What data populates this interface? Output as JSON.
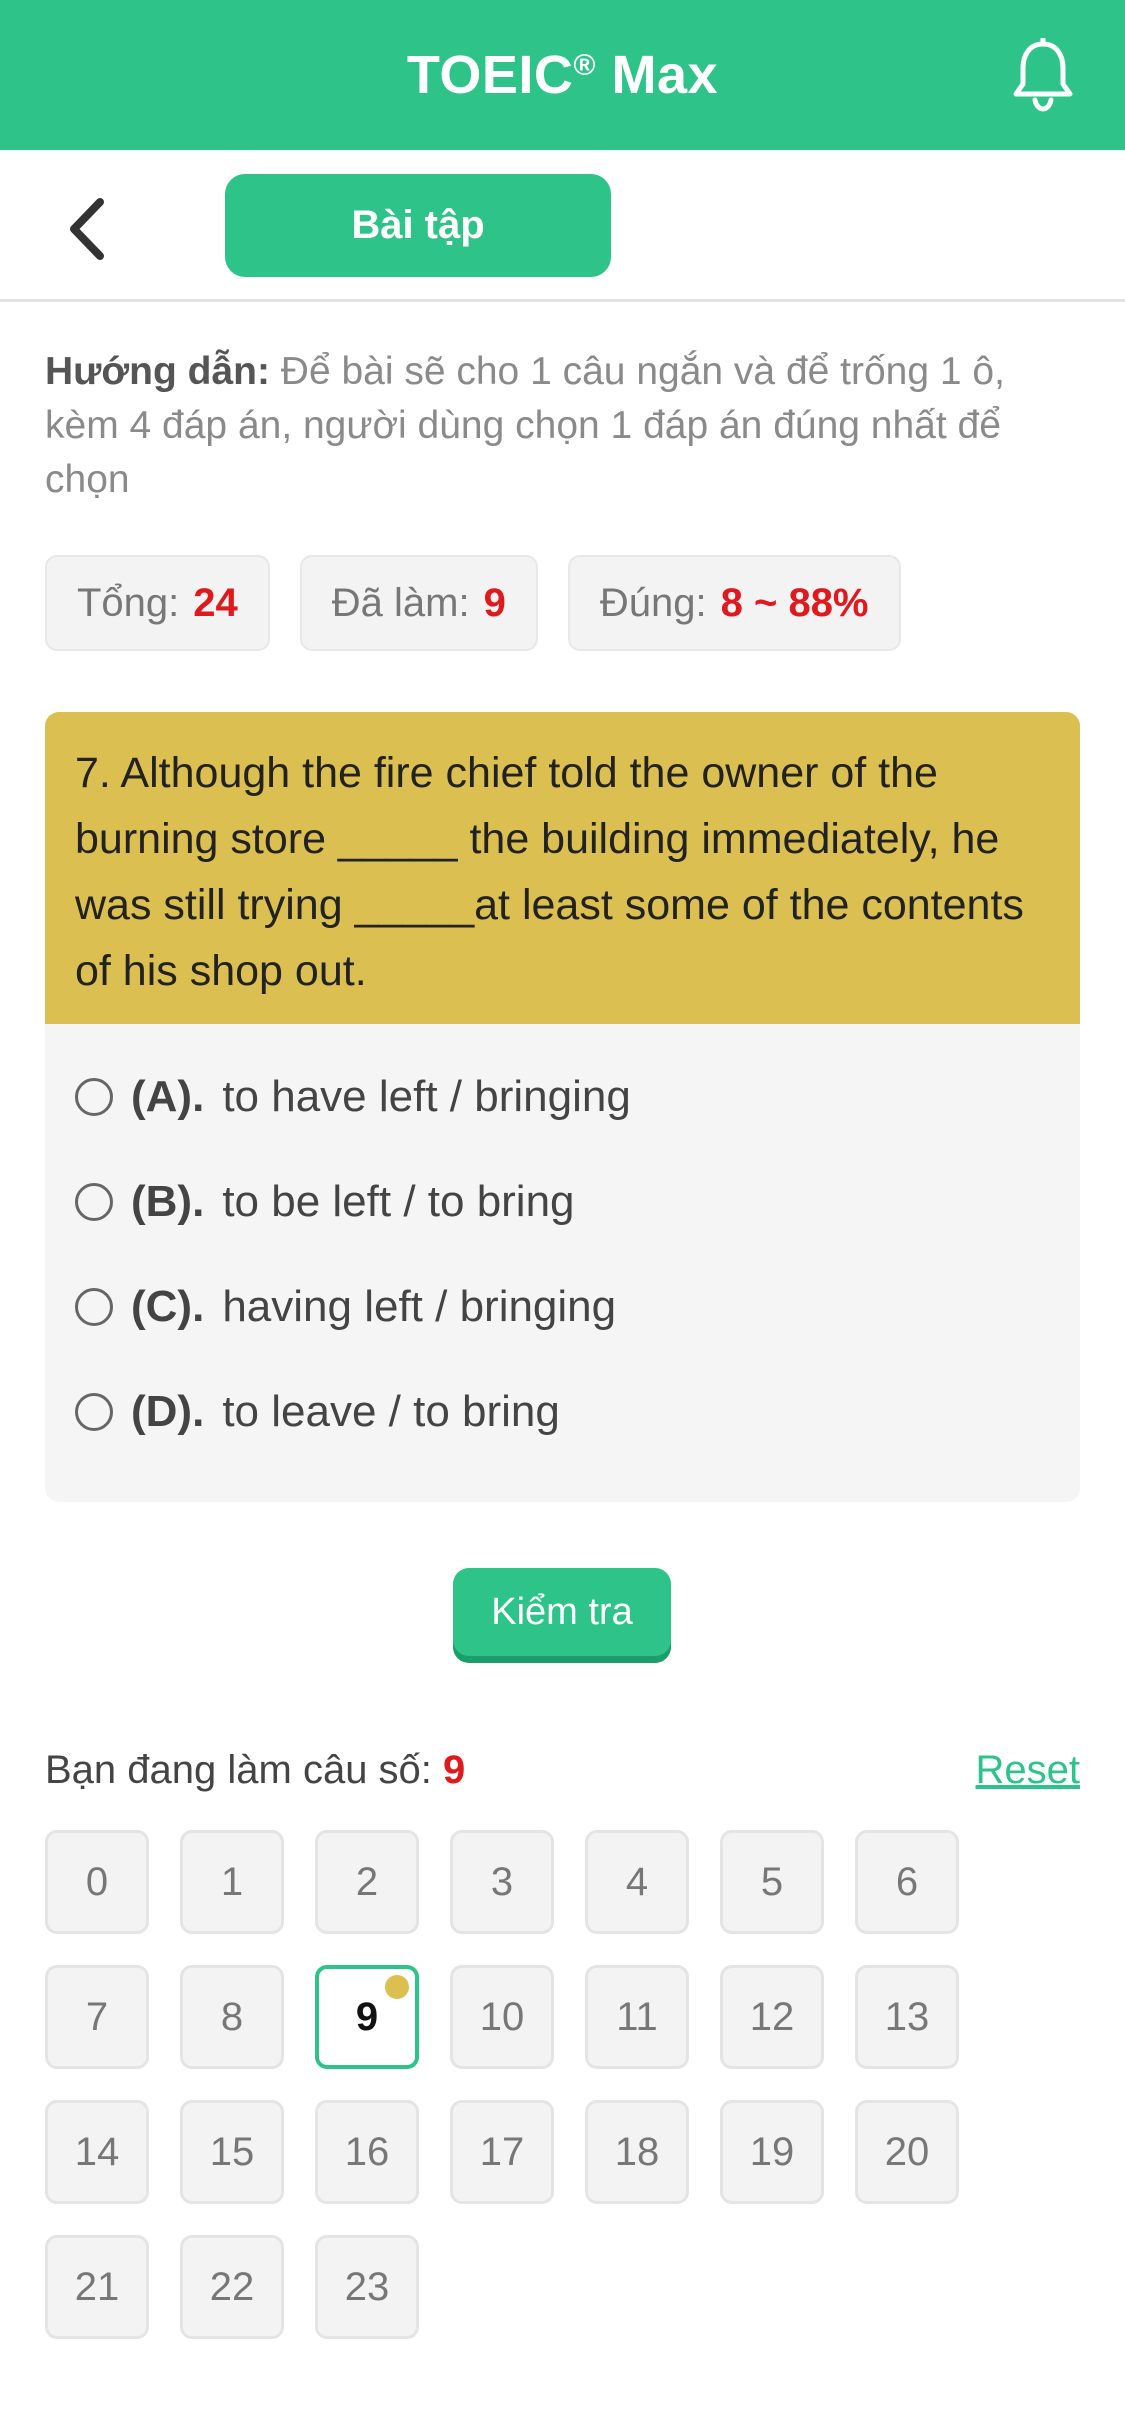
{
  "app_bar": {
    "title": "TOEIC",
    "title_mark": "®",
    "title_suffix": " Max"
  },
  "sub_header": {
    "tab_label": "Bài tập"
  },
  "instructions": {
    "lead": "Hướng dẫn:",
    "text": " Để bài sẽ cho 1 câu ngắn và để trống 1 ô, kèm 4 đáp án, người dùng chọn 1 đáp án đúng nhất để chọn"
  },
  "stats": [
    {
      "label": "Tổng:",
      "value": "24"
    },
    {
      "label": "Đã làm:",
      "value": "9"
    },
    {
      "label": "Đúng:",
      "value": "8 ~ 88%"
    }
  ],
  "question": {
    "text": "7. Although the fire chief told the owner of the burning store _____ the building immediately, he was still trying _____at least some of the contents of his shop out.",
    "options": [
      {
        "letter": "(A).",
        "text": "to have left / bringing"
      },
      {
        "letter": "(B).",
        "text": "to be left / to bring"
      },
      {
        "letter": "(C).",
        "text": "having left / bringing"
      },
      {
        "letter": "(D).",
        "text": "to leave / to bring"
      }
    ]
  },
  "check_button": {
    "label": "Kiểm tra"
  },
  "progress": {
    "current_label": "Bạn đang làm câu số:",
    "current_number": "9",
    "reset_label": "Reset",
    "cells": [
      "0",
      "1",
      "2",
      "3",
      "4",
      "5",
      "6",
      "7",
      "8",
      "9",
      "10",
      "11",
      "12",
      "13",
      "14",
      "15",
      "16",
      "17",
      "18",
      "19",
      "20",
      "21",
      "22",
      "23"
    ],
    "active_index": 9
  },
  "colors": {
    "brand": "#2ec489",
    "question_bg": "#dbc051",
    "value_red": "#e0191e"
  }
}
